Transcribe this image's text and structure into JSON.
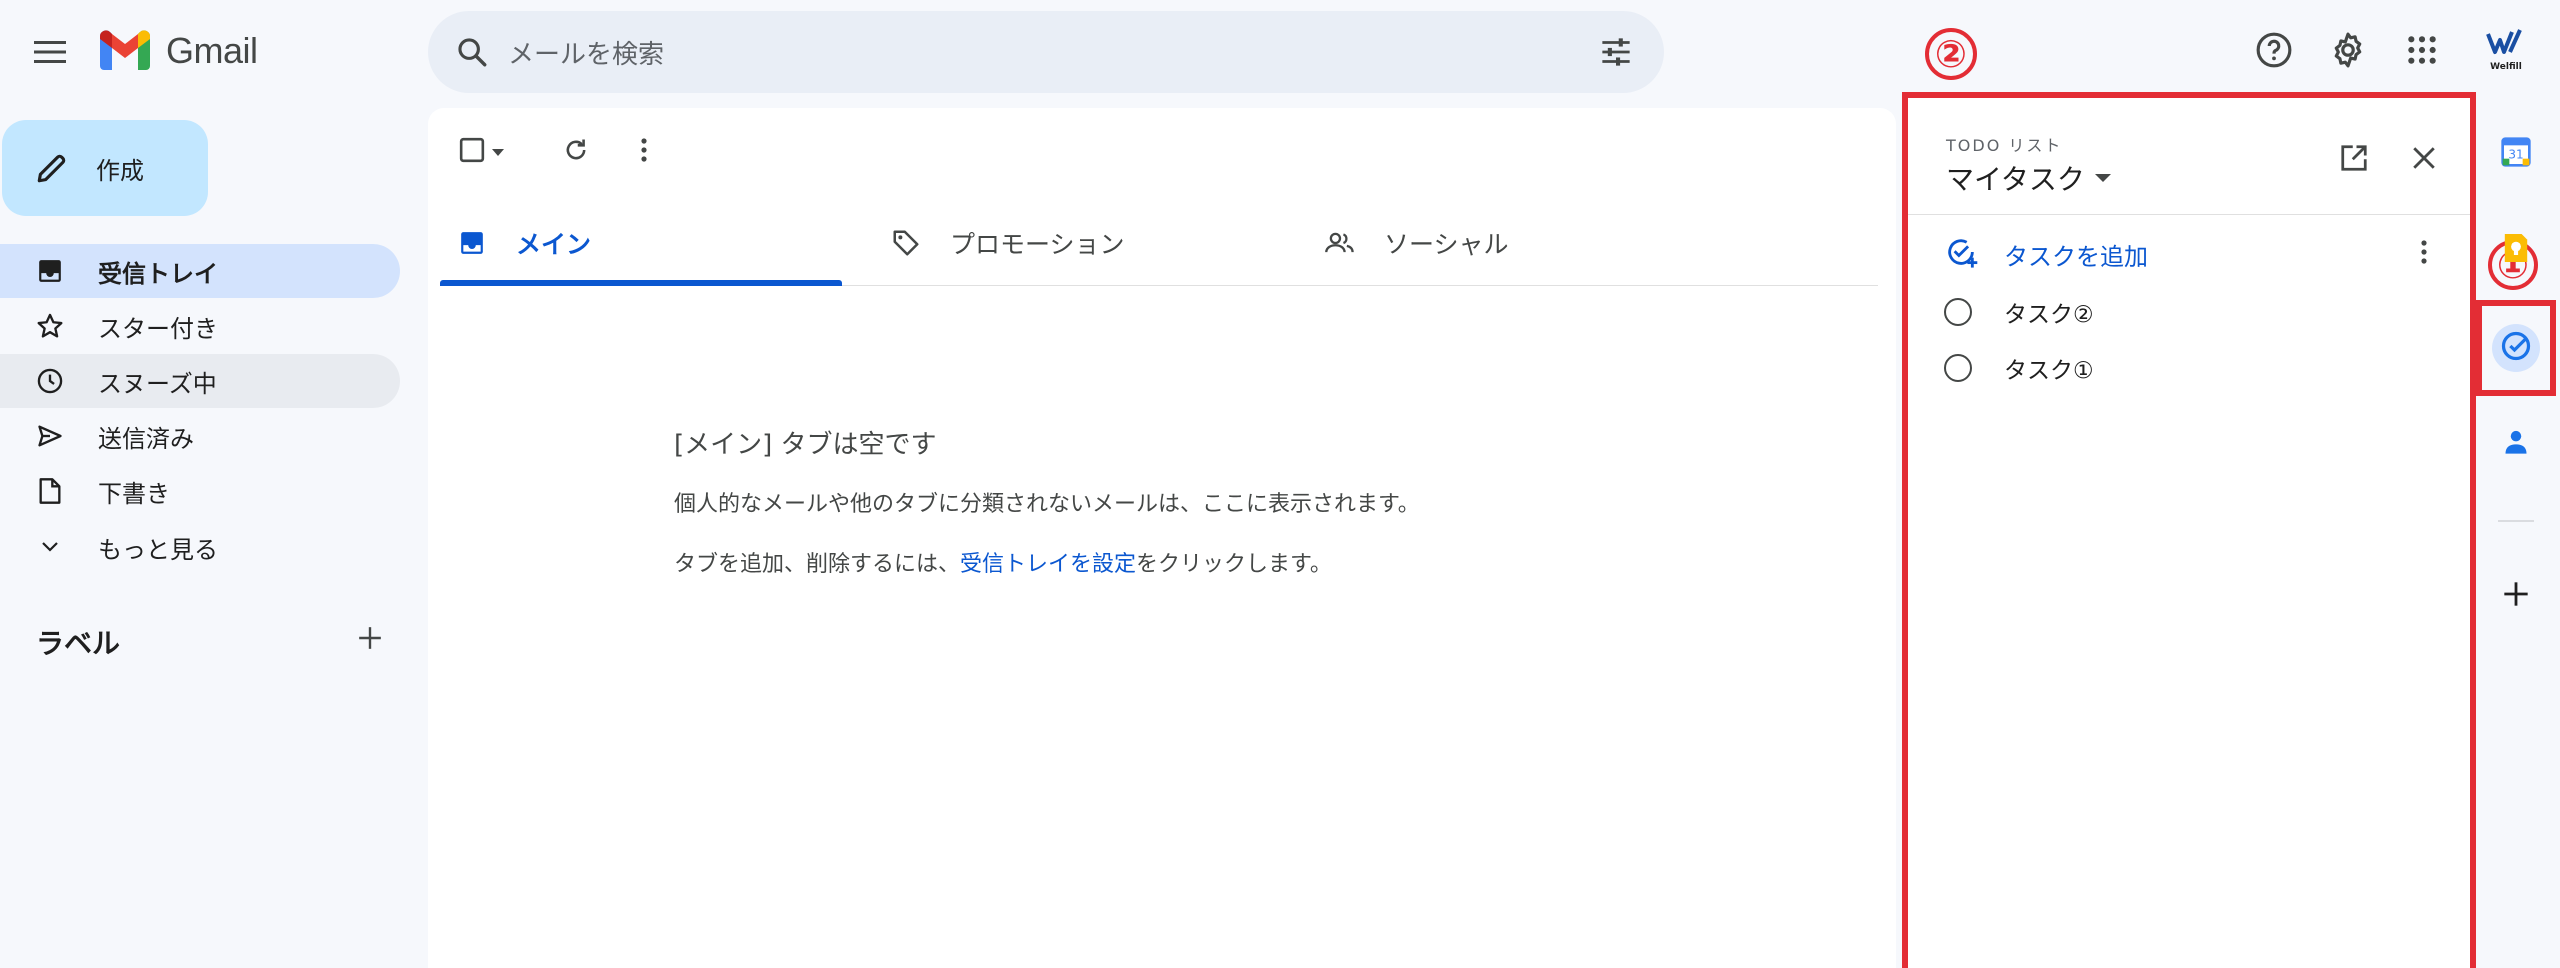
{
  "header": {
    "app_name": "Gmail",
    "search_placeholder": "メールを検索"
  },
  "sidebar": {
    "compose_label": "作成",
    "items": [
      {
        "label": "受信トレイ",
        "icon": "inbox-icon",
        "state": "active"
      },
      {
        "label": "スター付き",
        "icon": "star-icon",
        "state": "normal"
      },
      {
        "label": "スヌーズ中",
        "icon": "clock-icon",
        "state": "hover"
      },
      {
        "label": "送信済み",
        "icon": "send-icon",
        "state": "normal"
      },
      {
        "label": "下書き",
        "icon": "draft-icon",
        "state": "normal"
      },
      {
        "label": "もっと見る",
        "icon": "chevron-down-icon",
        "state": "normal"
      }
    ],
    "labels_heading": "ラベル"
  },
  "main": {
    "tabs": [
      {
        "label": "メイン",
        "icon": "inbox-icon",
        "active": true
      },
      {
        "label": "プロモーション",
        "icon": "tag-icon",
        "active": false
      },
      {
        "label": "ソーシャル",
        "icon": "people-icon",
        "active": false
      }
    ],
    "empty": {
      "title": "[メイン] タブは空です",
      "line1": "個人的なメールや他のタブに分類されないメールは、ここに表示されます。",
      "line2_prefix": "タブを追加、削除するには、",
      "line2_link": "受信トレイを設定",
      "line2_suffix": "をクリックします。"
    }
  },
  "tasks_panel": {
    "overline": "TODO リスト",
    "title": "マイタスク",
    "add_task_label": "タスクを追加",
    "tasks": [
      "タスク②",
      "タスク①"
    ]
  },
  "annotations": {
    "panel_marker": "②",
    "rail_marker": "①",
    "color": "#e32d35"
  },
  "brand": {
    "label": "Welfill"
  },
  "colors": {
    "accent": "#0b57d0",
    "active_nav": "#d3e3fd",
    "compose": "#c2e7ff",
    "search_bg": "#e9eef6"
  }
}
